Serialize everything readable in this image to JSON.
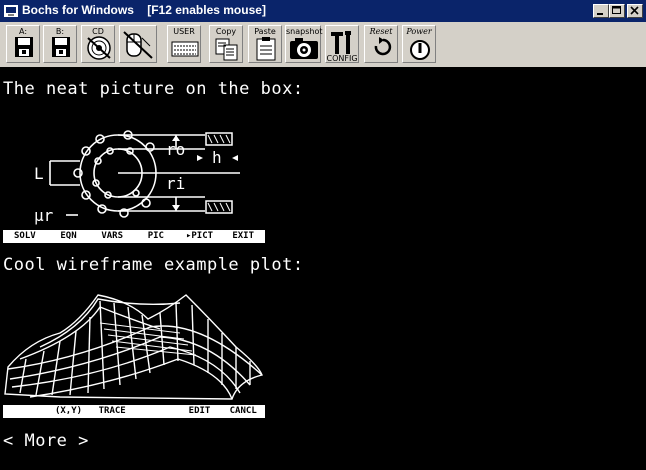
{
  "window": {
    "title": "Bochs for Windows",
    "hint": "[F12 enables mouse]"
  },
  "toolbar": {
    "floppy_a": "A:",
    "floppy_b": "B:",
    "cdrom": "CD",
    "user": "USER",
    "copy": "Copy",
    "paste": "Paste",
    "snapshot": "snapshot",
    "config": "CONFIG",
    "reset": "Reset",
    "power": "Power"
  },
  "screen": {
    "line1": "The neat picture on the box:",
    "line2": "Cool wireframe example plot:",
    "more": "< More >",
    "diagram": {
      "ro": "ro",
      "h": "h",
      "ri": "ri",
      "L": "L",
      "mu": "μr"
    },
    "menu1": [
      "SOLV",
      "EQN",
      "VARS",
      "PIC",
      "▸PICT",
      "EXIT"
    ],
    "menu2": [
      "",
      "(X,Y)",
      "TRACE",
      "",
      "EDIT",
      "CANCL"
    ]
  }
}
